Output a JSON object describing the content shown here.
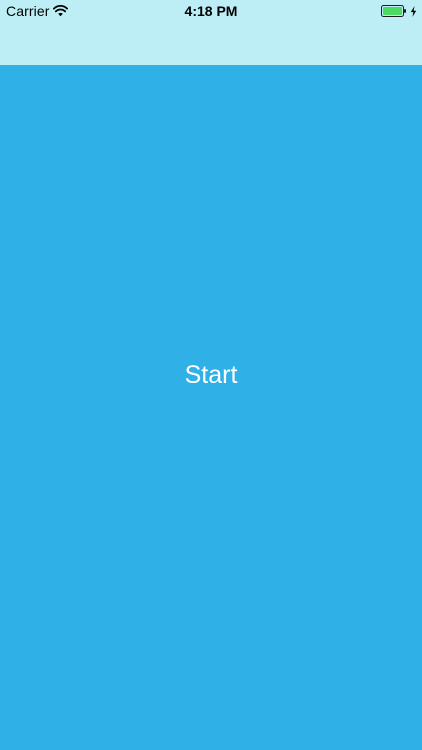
{
  "status_bar": {
    "carrier": "Carrier",
    "time": "4:18 PM",
    "icons": {
      "wifi": "wifi-icon",
      "battery": "battery-icon",
      "charging": "charging-icon"
    }
  },
  "main": {
    "start_label": "Start"
  },
  "colors": {
    "top_area": "#bdeef6",
    "background": "#2fb1e8",
    "battery_fill": "#4cd964",
    "text": "#ffffff"
  }
}
